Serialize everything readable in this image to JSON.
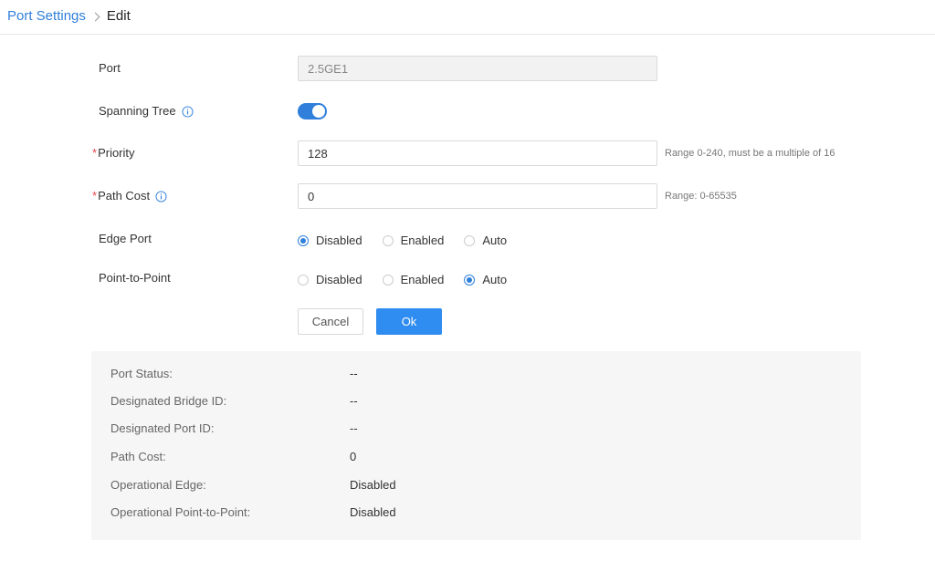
{
  "breadcrumb": {
    "parent": "Port Settings",
    "current": "Edit"
  },
  "form": {
    "port": {
      "label": "Port",
      "value": "2.5GE1"
    },
    "spanning_tree": {
      "label": "Spanning Tree",
      "enabled": true
    },
    "priority": {
      "required_mark": "*",
      "label": "Priority",
      "value": "128",
      "hint": "Range 0-240, must be a multiple of 16"
    },
    "path_cost": {
      "required_mark": "*",
      "label": "Path Cost",
      "value": "0",
      "hint": "Range: 0-65535"
    },
    "edge_port": {
      "label": "Edge Port",
      "options": [
        "Disabled",
        "Enabled",
        "Auto"
      ],
      "selected": "Disabled"
    },
    "point_to_point": {
      "label": "Point-to-Point",
      "options": [
        "Disabled",
        "Enabled",
        "Auto"
      ],
      "selected": "Auto"
    }
  },
  "buttons": {
    "cancel": "Cancel",
    "ok": "Ok"
  },
  "status": {
    "port_status": {
      "label": "Port Status:",
      "value": "--"
    },
    "designated_bridge_id": {
      "label": "Designated Bridge ID:",
      "value": "--"
    },
    "designated_port_id": {
      "label": "Designated Port ID:",
      "value": "--"
    },
    "path_cost": {
      "label": "Path Cost:",
      "value": "0"
    },
    "operational_edge": {
      "label": "Operational Edge:",
      "value": "Disabled"
    },
    "operational_p2p": {
      "label": "Operational Point-to-Point:",
      "value": "Disabled"
    }
  },
  "colors": {
    "accent": "#2f7fdb",
    "primary_button": "#2f8cf0",
    "required": "#e5484d",
    "panel_bg": "#f6f6f6"
  },
  "icons": {
    "info": "info-circle-icon",
    "breadcrumb_separator": "chevron-right-icon"
  }
}
